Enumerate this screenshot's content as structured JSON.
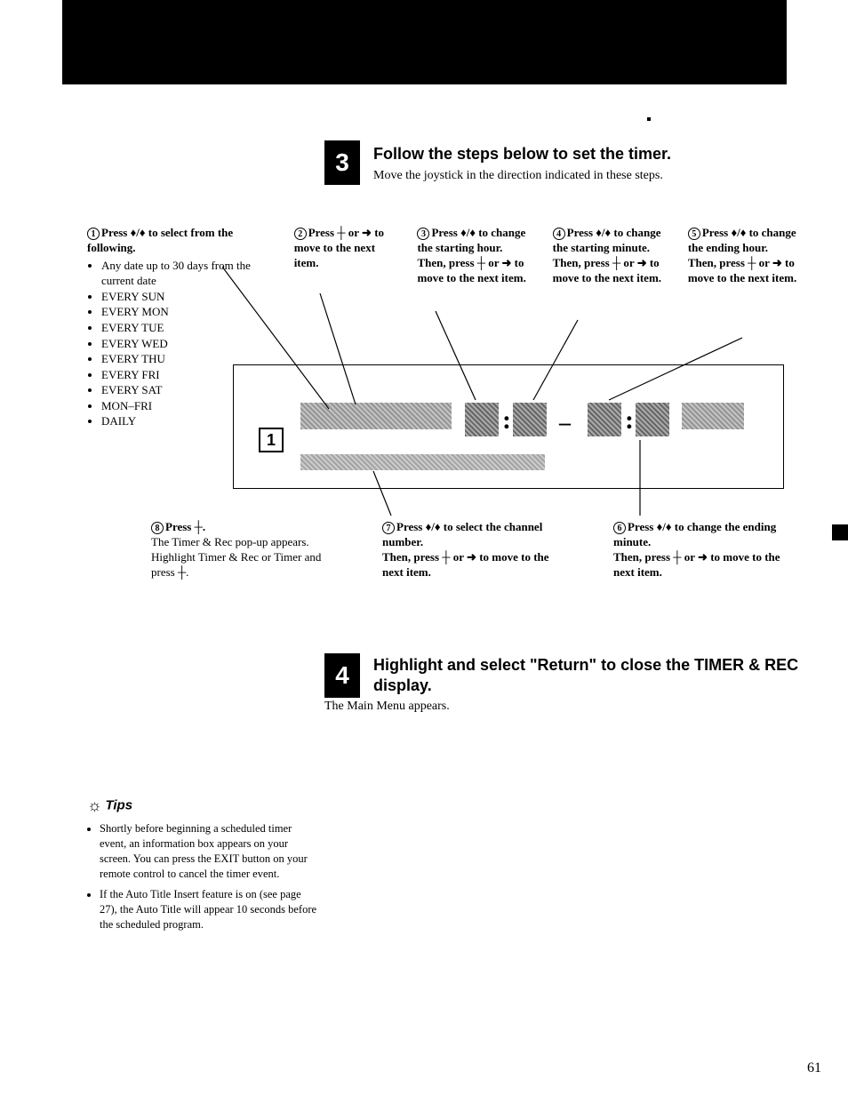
{
  "step3": {
    "num": "3",
    "title": "Follow the steps below to set the timer.",
    "sub": "Move the joystick in the direction indicated in these steps."
  },
  "cols": {
    "c1": {
      "num": "1",
      "head": "Press ♦/♦ to select from the following.",
      "items": [
        "Any date up to 30 days from the current date",
        "EVERY SUN",
        "EVERY MON",
        "EVERY TUE",
        "EVERY WED",
        "EVERY THU",
        "EVERY FRI",
        "EVERY SAT",
        "MON–FRI",
        "DAILY"
      ]
    },
    "c2": {
      "num": "2",
      "head": "Press ┼ or ➜ to move to the next item."
    },
    "c3": {
      "num": "3",
      "head": "Press ♦/♦ to change the starting hour.",
      "tail": "Then, press ┼ or ➜ to move to the next item."
    },
    "c4": {
      "num": "4",
      "head": "Press ♦/♦ to change the starting minute.",
      "tail": "Then, press ┼ or ➜ to move to the next item."
    },
    "c5": {
      "num": "5",
      "head": "Press ♦/♦ to change the ending hour.",
      "tail": "Then, press ┼ or ➜ to move to the next item."
    }
  },
  "diagram": {
    "one": "1",
    "colon": ":",
    "dash": "–"
  },
  "bcols": {
    "b8": {
      "num": "8",
      "head": "Press ┼.",
      "tail": "The Timer & Rec pop-up appears.\nHighlight Timer & Rec or Timer and press ┼."
    },
    "b7": {
      "num": "7",
      "head": "Press ♦/♦ to select the channel number.",
      "tail": "Then, press ┼ or ➜ to move to the next item."
    },
    "b6": {
      "num": "6",
      "head": "Press ♦/♦ to change the ending minute.",
      "tail": "Then, press ┼ or ➜ to move to the next item."
    }
  },
  "step4": {
    "num": "4",
    "title": "Highlight and select \"Return\" to close the TIMER & REC display.",
    "sub": "The Main Menu appears."
  },
  "tips": {
    "label": "Tips",
    "items": [
      "Shortly before beginning a scheduled timer event, an information box appears on your screen. You can press the EXIT button on your remote control to cancel the timer event.",
      "If the Auto Title Insert feature is on (see page 27), the Auto Title will appear 10 seconds before the scheduled program."
    ]
  },
  "page": "61"
}
